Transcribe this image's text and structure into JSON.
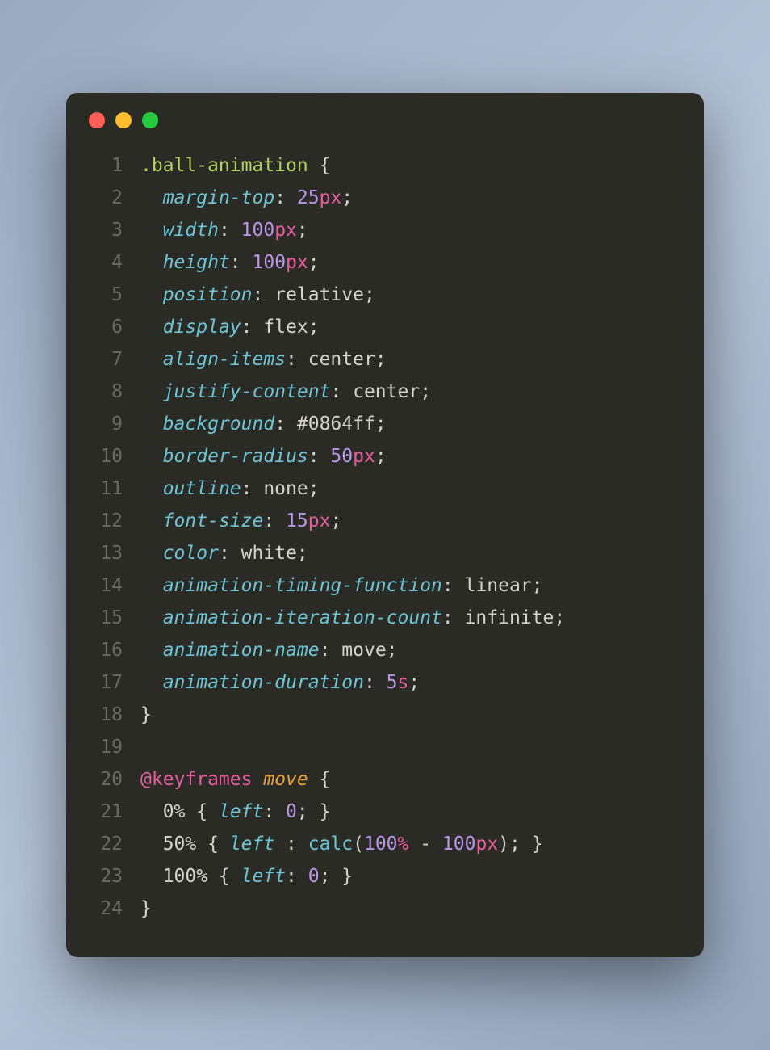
{
  "lineNumbers": [
    "1",
    "2",
    "3",
    "4",
    "5",
    "6",
    "7",
    "8",
    "9",
    "10",
    "11",
    "12",
    "13",
    "14",
    "15",
    "16",
    "17",
    "18",
    "19",
    "20",
    "21",
    "22",
    "23",
    "24"
  ],
  "lines": [
    {
      "tokens": [
        {
          "t": ".ball-animation ",
          "c": "selector"
        },
        {
          "t": "{",
          "c": "punct"
        }
      ]
    },
    {
      "tokens": [
        {
          "t": "  ",
          "c": "punct"
        },
        {
          "t": "margin-top",
          "c": "property"
        },
        {
          "t": ": ",
          "c": "punct"
        },
        {
          "t": "25",
          "c": "number"
        },
        {
          "t": "px",
          "c": "unit"
        },
        {
          "t": ";",
          "c": "punct"
        }
      ]
    },
    {
      "tokens": [
        {
          "t": "  ",
          "c": "punct"
        },
        {
          "t": "width",
          "c": "property"
        },
        {
          "t": ": ",
          "c": "punct"
        },
        {
          "t": "100",
          "c": "number"
        },
        {
          "t": "px",
          "c": "unit"
        },
        {
          "t": ";",
          "c": "punct"
        }
      ]
    },
    {
      "tokens": [
        {
          "t": "  ",
          "c": "punct"
        },
        {
          "t": "height",
          "c": "property"
        },
        {
          "t": ": ",
          "c": "punct"
        },
        {
          "t": "100",
          "c": "number"
        },
        {
          "t": "px",
          "c": "unit"
        },
        {
          "t": ";",
          "c": "punct"
        }
      ]
    },
    {
      "tokens": [
        {
          "t": "  ",
          "c": "punct"
        },
        {
          "t": "position",
          "c": "property"
        },
        {
          "t": ": relative;",
          "c": "punct"
        }
      ]
    },
    {
      "tokens": [
        {
          "t": "  ",
          "c": "punct"
        },
        {
          "t": "display",
          "c": "property"
        },
        {
          "t": ": flex;",
          "c": "punct"
        }
      ]
    },
    {
      "tokens": [
        {
          "t": "  ",
          "c": "punct"
        },
        {
          "t": "align-items",
          "c": "property"
        },
        {
          "t": ": center;",
          "c": "punct"
        }
      ]
    },
    {
      "tokens": [
        {
          "t": "  ",
          "c": "punct"
        },
        {
          "t": "justify-content",
          "c": "property"
        },
        {
          "t": ": center;",
          "c": "punct"
        }
      ]
    },
    {
      "tokens": [
        {
          "t": "  ",
          "c": "punct"
        },
        {
          "t": "background",
          "c": "property"
        },
        {
          "t": ": #0864ff;",
          "c": "punct"
        }
      ]
    },
    {
      "tokens": [
        {
          "t": "  ",
          "c": "punct"
        },
        {
          "t": "border-radius",
          "c": "property"
        },
        {
          "t": ": ",
          "c": "punct"
        },
        {
          "t": "50",
          "c": "number"
        },
        {
          "t": "px",
          "c": "unit"
        },
        {
          "t": ";",
          "c": "punct"
        }
      ]
    },
    {
      "tokens": [
        {
          "t": "  ",
          "c": "punct"
        },
        {
          "t": "outline",
          "c": "property"
        },
        {
          "t": ": none;",
          "c": "punct"
        }
      ]
    },
    {
      "tokens": [
        {
          "t": "  ",
          "c": "punct"
        },
        {
          "t": "font-size",
          "c": "property"
        },
        {
          "t": ": ",
          "c": "punct"
        },
        {
          "t": "15",
          "c": "number"
        },
        {
          "t": "px",
          "c": "unit"
        },
        {
          "t": ";",
          "c": "punct"
        }
      ]
    },
    {
      "tokens": [
        {
          "t": "  ",
          "c": "punct"
        },
        {
          "t": "color",
          "c": "property"
        },
        {
          "t": ": white;",
          "c": "punct"
        }
      ]
    },
    {
      "tokens": [
        {
          "t": "  ",
          "c": "punct"
        },
        {
          "t": "animation-timing-function",
          "c": "property"
        },
        {
          "t": ": linear;",
          "c": "punct"
        }
      ]
    },
    {
      "tokens": [
        {
          "t": "  ",
          "c": "punct"
        },
        {
          "t": "animation-iteration-count",
          "c": "property"
        },
        {
          "t": ": infinite;",
          "c": "punct"
        }
      ]
    },
    {
      "tokens": [
        {
          "t": "  ",
          "c": "punct"
        },
        {
          "t": "animation-name",
          "c": "property"
        },
        {
          "t": ": move;",
          "c": "punct"
        }
      ]
    },
    {
      "tokens": [
        {
          "t": "  ",
          "c": "punct"
        },
        {
          "t": "animation-duration",
          "c": "property"
        },
        {
          "t": ": ",
          "c": "punct"
        },
        {
          "t": "5",
          "c": "number"
        },
        {
          "t": "s",
          "c": "unit"
        },
        {
          "t": ";",
          "c": "punct"
        }
      ]
    },
    {
      "tokens": [
        {
          "t": "}",
          "c": "punct"
        }
      ]
    },
    {
      "tokens": [
        {
          "t": "",
          "c": "punct"
        }
      ]
    },
    {
      "tokens": [
        {
          "t": "@keyframes",
          "c": "keyword"
        },
        {
          "t": " ",
          "c": "punct"
        },
        {
          "t": "move",
          "c": "name-ital"
        },
        {
          "t": " {",
          "c": "punct"
        }
      ]
    },
    {
      "tokens": [
        {
          "t": "  0% { ",
          "c": "punct"
        },
        {
          "t": "left",
          "c": "property"
        },
        {
          "t": ": ",
          "c": "punct"
        },
        {
          "t": "0",
          "c": "number"
        },
        {
          "t": "; }",
          "c": "punct"
        }
      ]
    },
    {
      "tokens": [
        {
          "t": "  50% { ",
          "c": "punct"
        },
        {
          "t": "left",
          "c": "property"
        },
        {
          "t": " : ",
          "c": "punct"
        },
        {
          "t": "calc",
          "c": "func"
        },
        {
          "t": "(",
          "c": "punct"
        },
        {
          "t": "100",
          "c": "number"
        },
        {
          "t": "%",
          "c": "unit"
        },
        {
          "t": " - ",
          "c": "punct"
        },
        {
          "t": "100",
          "c": "number"
        },
        {
          "t": "px",
          "c": "unit"
        },
        {
          "t": "); }",
          "c": "punct"
        }
      ]
    },
    {
      "tokens": [
        {
          "t": "  100% { ",
          "c": "punct"
        },
        {
          "t": "left",
          "c": "property"
        },
        {
          "t": ": ",
          "c": "punct"
        },
        {
          "t": "0",
          "c": "number"
        },
        {
          "t": "; }",
          "c": "punct"
        }
      ]
    },
    {
      "tokens": [
        {
          "t": "}",
          "c": "punct"
        }
      ]
    }
  ]
}
